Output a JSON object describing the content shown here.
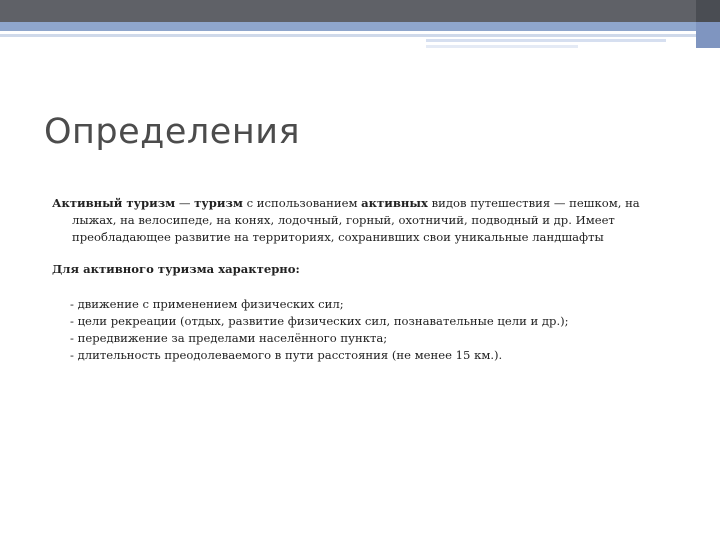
{
  "slide": {
    "title": "Определения",
    "definition": {
      "bold1": "Активный туризм",
      "text1": " — ",
      "bold2": "туризм",
      "text2": " с использованием ",
      "bold3": "активных",
      "text3": " видов путешествия — пешком, на лыжах, на велосипеде, на конях, лодочный, горный, охотничий, подводный и др. Имеет преобладающее развитие на территориях, сохранивших свои уникальные ландшафты"
    },
    "subheading": "Для активного туризма характерно:",
    "items": [
      "- движение с применением физических сил;",
      "- цели рекреации (отдых, развитие физических сил, познавательные цели и др.);",
      "- передвижение за пределами населённого пункта;",
      "- длительность преодолеваемого в пути расстояния (не менее 15 км.)."
    ]
  }
}
